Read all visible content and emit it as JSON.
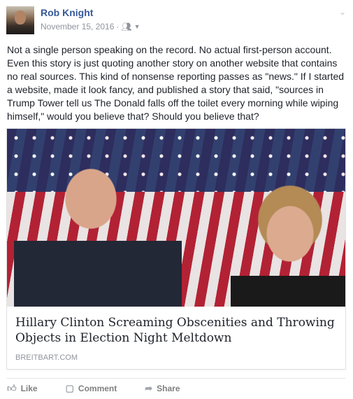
{
  "post": {
    "author": "Rob Knight",
    "date": "November 15, 2016",
    "separator": "·",
    "audience_icon": "friends-icon",
    "text": "Not a single person speaking on the record. No actual first-person account. Even this story is just quoting another story on another website that contains no real sources. This kind of nonsense reporting passes as \"news.\" If I started a website, made it look fancy, and published a story that said, \"sources in Trump Tower tell us The Donald falls off the toilet every morning while wiping himself,\" would you believe that? Should you believe that?"
  },
  "link": {
    "headline": "Hillary Clinton Screaming Obscenities and Throwing Objects in Election Night Meltdown",
    "domain": "BREITBART.COM"
  },
  "actions": {
    "like": "Like",
    "comment": "Comment",
    "share": "Share"
  },
  "colors": {
    "author": "#365899",
    "meta": "#90949c"
  }
}
